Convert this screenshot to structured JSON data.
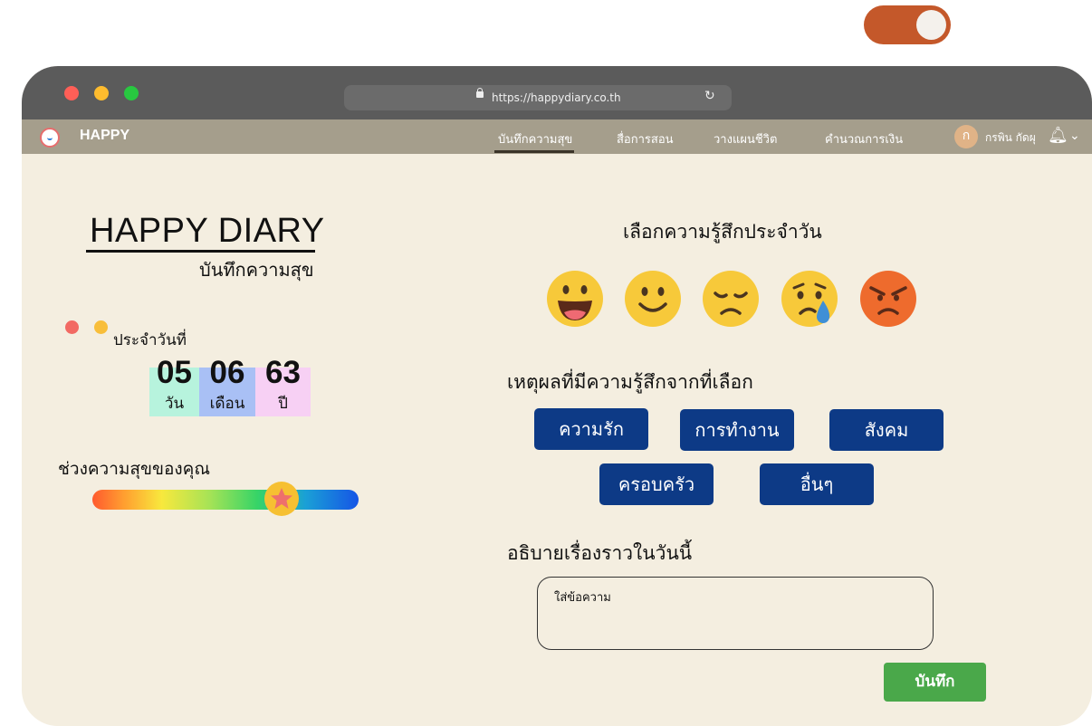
{
  "theme_toggle": {
    "on": true,
    "color": "#c4582a"
  },
  "browser": {
    "url": "https://happydiary.co.th",
    "window_dots": [
      "#ff5f57",
      "#febc2e",
      "#28c840"
    ]
  },
  "nav": {
    "brand": "HAPPY",
    "links": [
      "บันทึกความสุข",
      "สื่อการสอน",
      "วางแผนชีวิต",
      "คำนวณการเงิน"
    ],
    "active_index": 0,
    "avatar_initial": "ก",
    "user_name": "กรพิน กัดผุ"
  },
  "left": {
    "title": "HAPPY DIARY",
    "subtitle": "บันทึกความสุข",
    "date_label": "ประจำวันที่",
    "date": [
      {
        "value": "05",
        "unit": "วัน",
        "color": "#b7f3dd"
      },
      {
        "value": "06",
        "unit": "เดือน",
        "color": "#a9c0f5"
      },
      {
        "value": "63",
        "unit": "ปี",
        "color": "#f7d0f4"
      }
    ],
    "happiness_label": "ช่วงความสุขของคุณ",
    "happiness_level": 0.71
  },
  "right": {
    "emotion_title": "เลือกความรู้สึกประจำวัน",
    "emotions": [
      "laughing-face-icon",
      "smiling-face-icon",
      "sad-face-icon",
      "crying-face-icon",
      "angry-face-icon"
    ],
    "reason_title": "เหตุผลที่มีความรู้สึกจากที่เลือก",
    "reasons": [
      "ความรัก",
      "การทำงาน",
      "สังคม",
      "ครอบครัว",
      "อื่นๆ"
    ],
    "description_title": "อธิบายเรื่องราวในวันนี้",
    "description_placeholder": "ใส่ข้อความ",
    "save_label": "บันทึก"
  },
  "colors": {
    "background": "#f4eee0",
    "navbar": "#a59e8c",
    "titlebar": "#5b5b5b",
    "reason_button": "#0d3a86",
    "save_button": "#4aa84a"
  }
}
